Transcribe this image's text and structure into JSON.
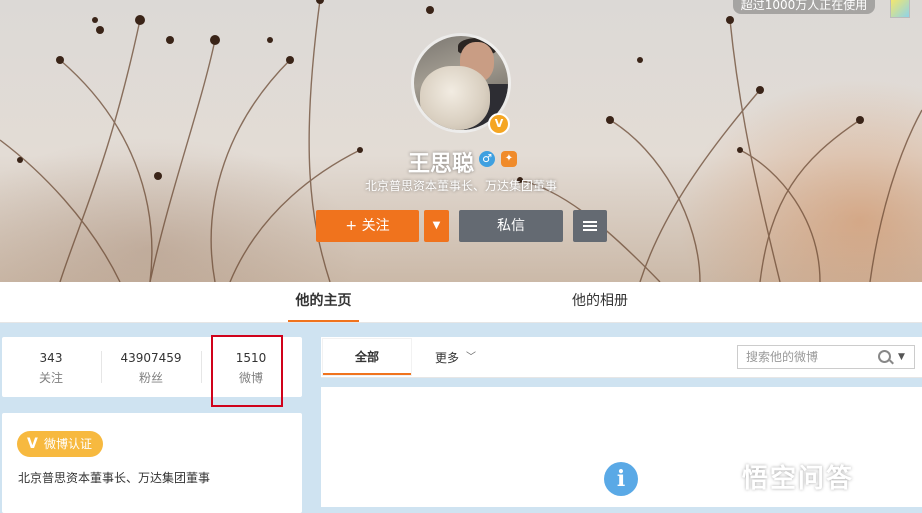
{
  "cover": {
    "online_badge": "超过1000万人正在使用"
  },
  "profile": {
    "name": "王思聪",
    "verified_mark": "V",
    "gender_icon": "male-icon",
    "description": "北京普思资本董事长、万达集团董事",
    "follow_button": "+ 关注",
    "message_button": "私信"
  },
  "tabs": [
    {
      "label": "他的主页",
      "active": true
    },
    {
      "label": "他的相册",
      "active": false
    }
  ],
  "stats": [
    {
      "value": "343",
      "label": "关注"
    },
    {
      "value": "43907459",
      "label": "粉丝"
    },
    {
      "value": "1510",
      "label": "微博"
    }
  ],
  "verification": {
    "badge_letter": "V",
    "badge_label": "微博认证",
    "description": "北京普思资本董事长、万达集团董事"
  },
  "feed": {
    "tab_all": "全部",
    "tab_more": "更多",
    "search_placeholder": "搜索他的微博",
    "info_icon": "i"
  },
  "watermark": {
    "text": "悟空问答"
  },
  "colors": {
    "accent_orange": "#f0731d",
    "button_gray": "#646a72",
    "verify_gold": "#f7b93f",
    "highlight_red": "#d0021b"
  }
}
